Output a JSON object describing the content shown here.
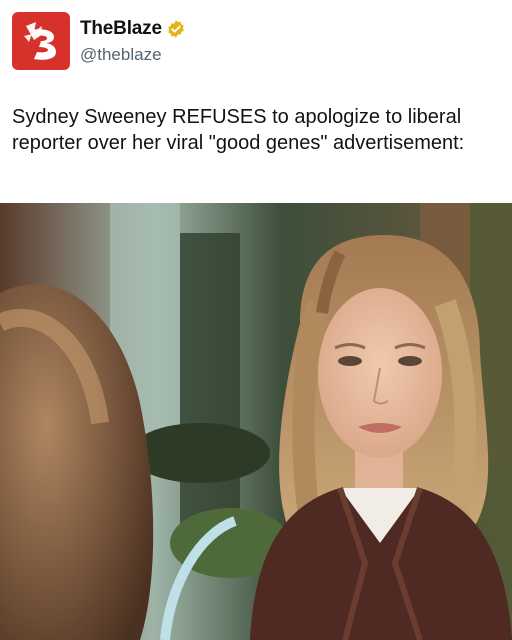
{
  "account": {
    "display_name": "TheBlaze",
    "handle": "@theblaze",
    "verified": true,
    "verified_color": "#e7b416",
    "avatar_color": "#d7312c",
    "avatar_icon": "blaze-logo-icon"
  },
  "tweet": {
    "text": "Sydney Sweeney REFUSES to apologize to liberal reporter over her viral \"good genes\" advertisement:"
  },
  "media": {
    "type": "photo",
    "description_icon": "interview-photo"
  }
}
